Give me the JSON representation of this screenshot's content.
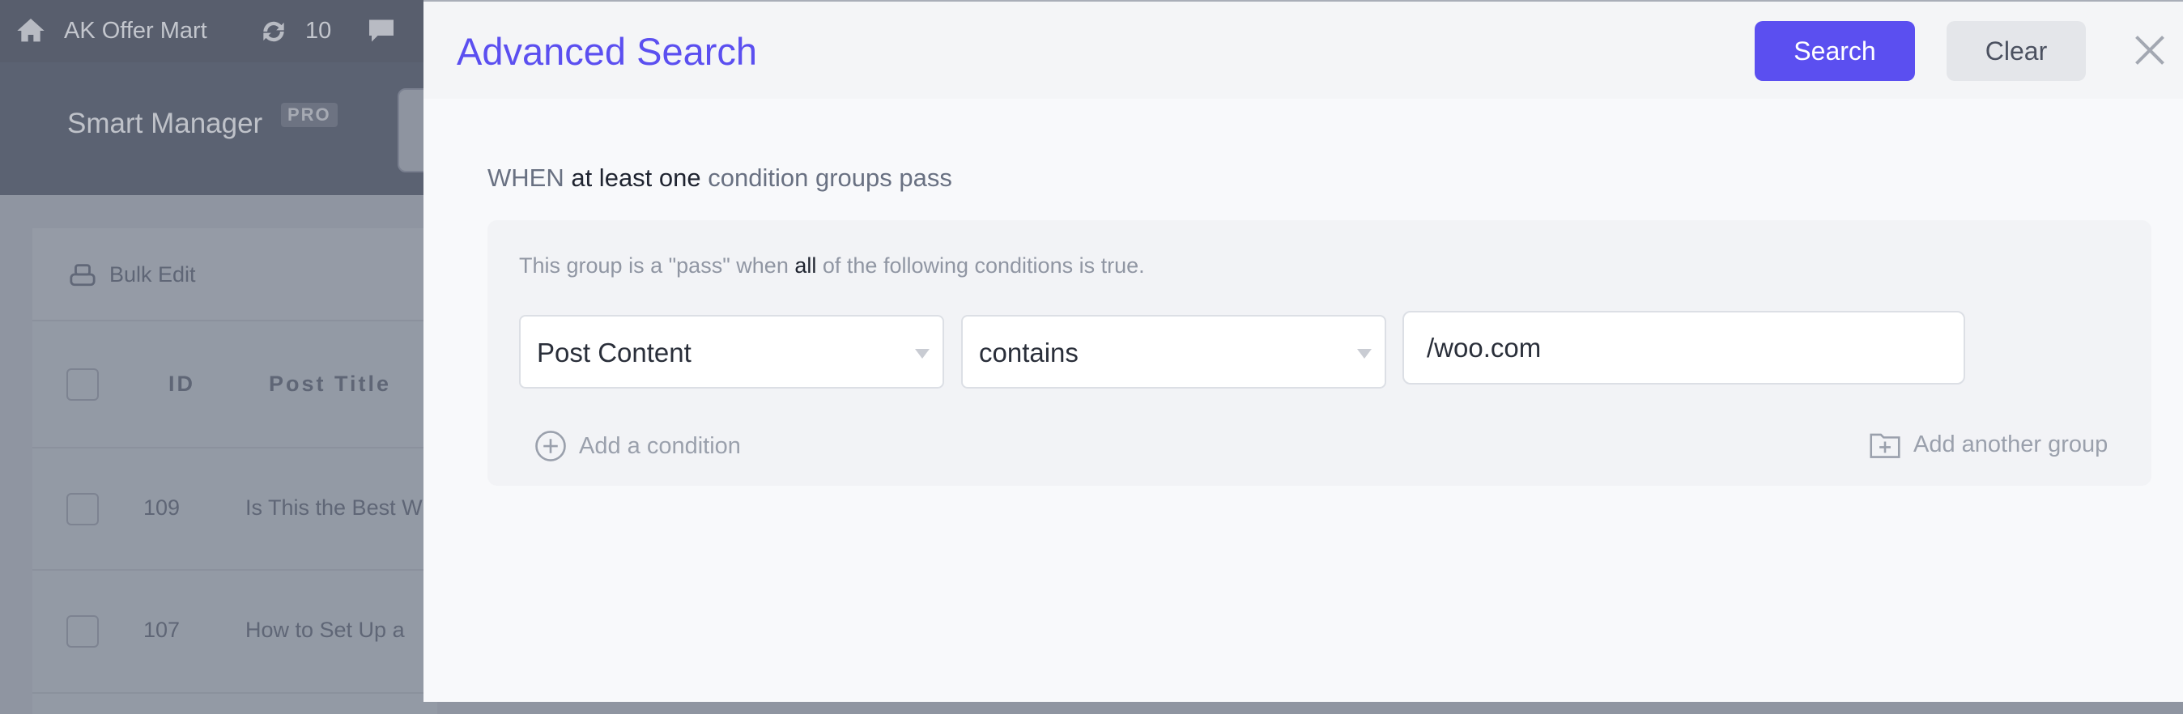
{
  "background": {
    "site_name": "AK Offer Mart",
    "updates_count": "10",
    "app_title": "Smart Manager",
    "app_badge": "PRO",
    "bulk_edit": "Bulk Edit",
    "columns": [
      "ID",
      "Post Title"
    ],
    "rows": [
      {
        "id": "109",
        "title": "Is This the Best W"
      },
      {
        "id": "107",
        "title": "How to Set Up a"
      }
    ]
  },
  "panel": {
    "title": "Advanced Search",
    "search_label": "Search",
    "clear_label": "Clear",
    "when_prefix": "WHEN",
    "when_mode": "at least one",
    "when_suffix": "condition groups pass",
    "group": {
      "desc_prefix": "This group is a \"pass\" when",
      "desc_mode": "all",
      "desc_suffix": "of the following conditions is true.",
      "field": "Post Content",
      "operator": "contains",
      "value": "/woo.com",
      "add_condition": "Add a condition",
      "add_group": "Add another group"
    },
    "accent_color": "#5b4ff0"
  }
}
